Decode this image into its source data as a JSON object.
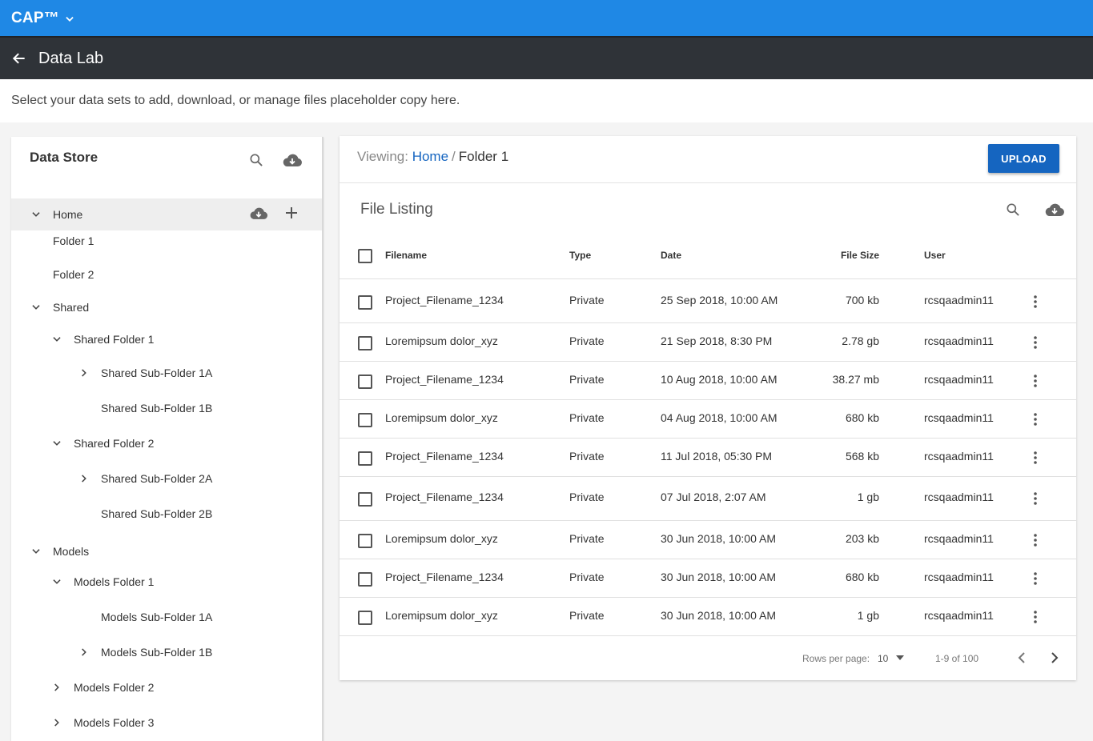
{
  "app": {
    "brand": "CAP™",
    "title": "Data Lab"
  },
  "subtitle": "Select your data sets to add, download, or manage files placeholder copy here.",
  "data_store": {
    "title": "Data Store",
    "tree": [
      {
        "label": "Home",
        "caret": "down",
        "indent": 0,
        "active": true
      },
      {
        "label": "Folder 1",
        "caret": "",
        "indent": 0
      },
      {
        "label": "Folder 2",
        "caret": "",
        "indent": 0
      },
      {
        "label": "Shared",
        "caret": "down",
        "indent": 0
      },
      {
        "label": "Shared Folder 1",
        "caret": "down",
        "indent": 1
      },
      {
        "label": "Shared Sub-Folder 1A",
        "caret": "right",
        "indent": 2
      },
      {
        "label": "Shared Sub-Folder 1B",
        "caret": "",
        "indent": 2
      },
      {
        "label": "Shared Folder 2",
        "caret": "down",
        "indent": 1
      },
      {
        "label": "Shared Sub-Folder 2A",
        "caret": "right",
        "indent": 2
      },
      {
        "label": "Shared Sub-Folder 2B",
        "caret": "",
        "indent": 2
      },
      {
        "label": "Models",
        "caret": "down",
        "indent": 0
      },
      {
        "label": "Models Folder 1",
        "caret": "down",
        "indent": 1
      },
      {
        "label": "Models Sub-Folder 1A",
        "caret": "",
        "indent": 2
      },
      {
        "label": "Models Sub-Folder 1B",
        "caret": "right",
        "indent": 2
      },
      {
        "label": "Models Folder 2",
        "caret": "right",
        "indent": 1
      },
      {
        "label": "Models Folder 3",
        "caret": "right",
        "indent": 1
      }
    ]
  },
  "breadcrumb": {
    "prefix": "Viewing:",
    "home": "Home",
    "separator": "/",
    "current": "Folder 1"
  },
  "upload_label": "UPLOAD",
  "file_listing": {
    "title": "File Listing",
    "columns": {
      "filename": "Filename",
      "type": "Type",
      "date": "Date",
      "size": "File Size",
      "user": "User"
    },
    "rows": [
      {
        "filename": "Project_Filename_1234",
        "type": "Private",
        "date": "25 Sep 2018, 10:00 AM",
        "size": "700 kb",
        "user": "rcsqaadmin11"
      },
      {
        "filename": "Loremipsum dolor_xyz",
        "type": "Private",
        "date": "21 Sep 2018, 8:30 PM",
        "size": "2.78 gb",
        "user": "rcsqaadmin11"
      },
      {
        "filename": "Project_Filename_1234",
        "type": "Private",
        "date": "10 Aug 2018, 10:00 AM",
        "size": "38.27 mb",
        "user": "rcsqaadmin11"
      },
      {
        "filename": "Loremipsum dolor_xyz",
        "type": "Private",
        "date": "04 Aug 2018, 10:00 AM",
        "size": "680 kb",
        "user": "rcsqaadmin11"
      },
      {
        "filename": "Project_Filename_1234",
        "type": "Private",
        "date": "11 Jul 2018, 05:30 PM",
        "size": "568 kb",
        "user": "rcsqaadmin11"
      },
      {
        "filename": "Project_Filename_1234",
        "type": "Private",
        "date": "07 Jul 2018, 2:07 AM",
        "size": "1 gb",
        "user": "rcsqaadmin11"
      },
      {
        "filename": "Loremipsum dolor_xyz",
        "type": "Private",
        "date": "30 Jun 2018, 10:00 AM",
        "size": "203 kb",
        "user": "rcsqaadmin11"
      },
      {
        "filename": "Project_Filename_1234",
        "type": "Private",
        "date": "30 Jun 2018, 10:00 AM",
        "size": "680 kb",
        "user": "rcsqaadmin11"
      },
      {
        "filename": "Loremipsum dolor_xyz",
        "type": "Private",
        "date": "30 Jun 2018, 10:00 AM",
        "size": "1 gb",
        "user": "rcsqaadmin11"
      }
    ]
  },
  "pagination": {
    "rows_per_page_label": "Rows per page:",
    "rows_per_page": "10",
    "range": "1-9 of 100"
  },
  "colors": {
    "brand_blue": "#1f88e5",
    "titlebar": "#2f3338",
    "upload_blue": "#1565c0",
    "link": "#1565c0"
  }
}
